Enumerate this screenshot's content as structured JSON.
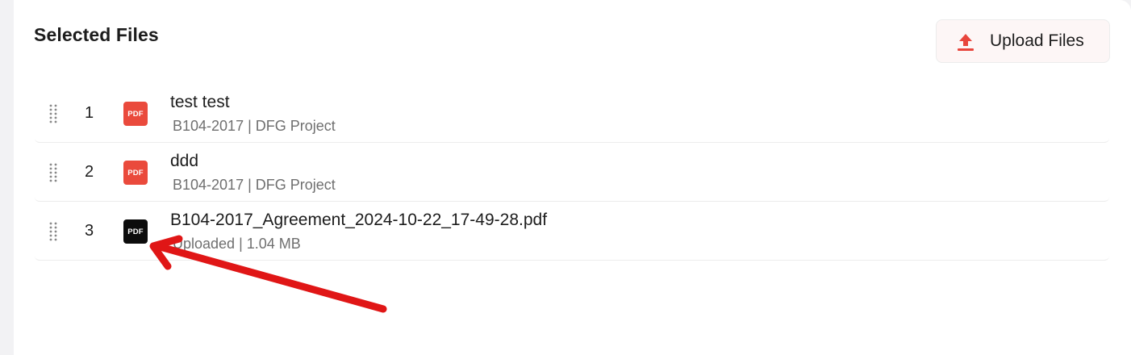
{
  "section": {
    "title": "Selected Files"
  },
  "upload_button": {
    "label": "Upload Files",
    "icon": "upload-icon",
    "icon_color": "#e8453c"
  },
  "files": [
    {
      "index": "1",
      "name": "test test",
      "meta": "B104-2017 | DFG Project",
      "icon_label": "PDF",
      "icon_color": "#ea4a3c"
    },
    {
      "index": "2",
      "name": "ddd",
      "meta": "B104-2017 | DFG Project",
      "icon_label": "PDF",
      "icon_color": "#ea4a3c"
    },
    {
      "index": "3",
      "name": "B104-2017_Agreement_2024-10-22_17-49-28.pdf",
      "meta": "Uploaded | 1.04 MB",
      "icon_label": "PDF",
      "icon_color": "#0c0c0c"
    }
  ],
  "annotation": {
    "type": "arrow",
    "color": "#e01616",
    "points_to": "file 3 pdf icon"
  }
}
